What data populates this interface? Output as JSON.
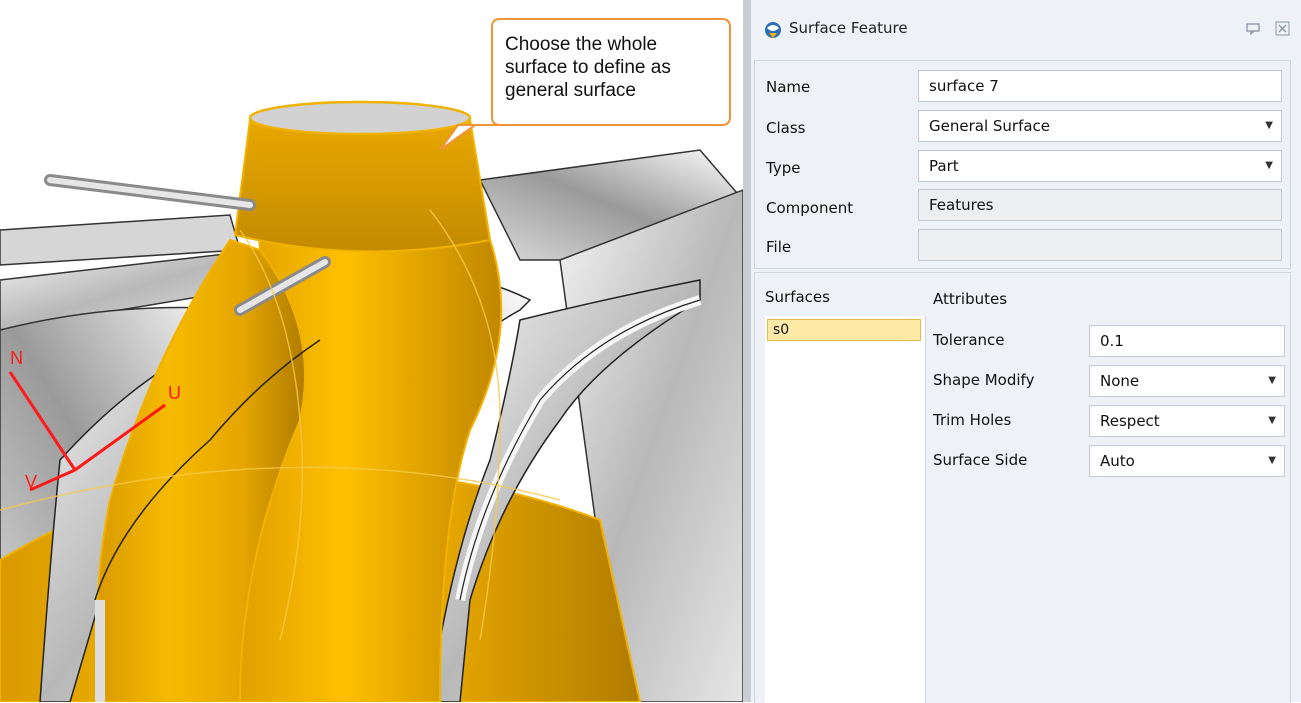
{
  "callout": {
    "lines": [
      "Choose the whole",
      "surface to define as",
      "general surface"
    ]
  },
  "axes": {
    "n": "N",
    "u": "U",
    "v": "V"
  },
  "colors": {
    "highlight": "#f2b200",
    "axis": "#ff1a1a",
    "callout_border": "#f0943a"
  },
  "panel": {
    "title": "Surface Feature",
    "title_icon": "surface-feature-icon",
    "fields": {
      "name_label": "Name",
      "name_value": "surface 7",
      "class_label": "Class",
      "class_value": "General Surface",
      "type_label": "Type",
      "type_value": "Part",
      "component_label": "Component",
      "component_value": "Features",
      "file_label": "File",
      "file_value": ""
    },
    "surfaces": {
      "header": "Surfaces",
      "items": [
        "s0"
      ]
    },
    "attributes": {
      "header": "Attributes",
      "tolerance_label": "Tolerance",
      "tolerance_value": "0.1",
      "shape_modify_label": "Shape Modify",
      "shape_modify_value": "None",
      "trim_holes_label": "Trim Holes",
      "trim_holes_value": "Respect",
      "surface_side_label": "Surface Side",
      "surface_side_value": "Auto"
    }
  }
}
